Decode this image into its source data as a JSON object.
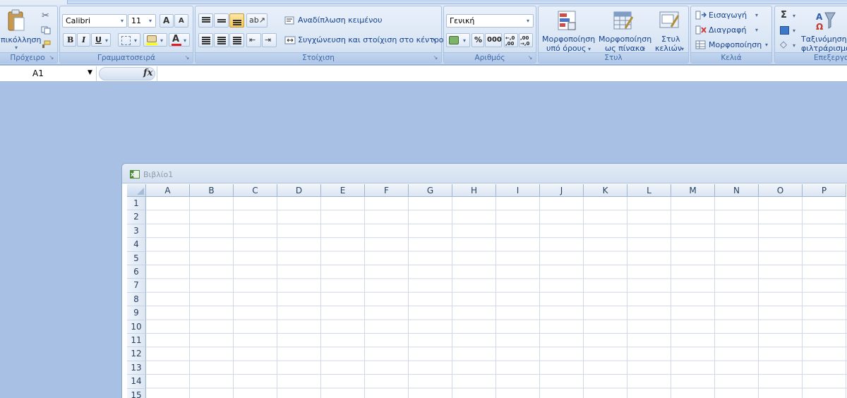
{
  "ribbon": {
    "clipboard": {
      "paste_label": "πικόλληση",
      "group_label": "Πρόχειρο"
    },
    "font": {
      "font_name": "Calibri",
      "font_size": "11",
      "grow_label": "A",
      "shrink_label": "A",
      "bold_label": "B",
      "italic_label": "I",
      "underline_label": "U",
      "color_label": "A",
      "group_label": "Γραμματοσειρά"
    },
    "alignment": {
      "wrap_label": "Αναδίπλωση κειμένου",
      "merge_label": "Συγχώνευση και στοίχιση στο κέντρο",
      "group_label": "Στοίχιση"
    },
    "number": {
      "format_value": "Γενική",
      "percent_label": "%",
      "comma_label": "000",
      "inc_decimal_label": "←,0 ,00",
      "dec_decimal_label": ",00 →,0",
      "group_label": "Αριθμός"
    },
    "styles": {
      "conditional_label_1": "Μορφοποίηση",
      "conditional_label_2": "υπό όρους",
      "table_label_1": "Μορφοποίηση",
      "table_label_2": "ως πίνακα",
      "cell_styles_label_1": "Στυλ",
      "cell_styles_label_2": "κελιών",
      "group_label": "Στυλ"
    },
    "cells": {
      "insert_label": "Εισαγωγή",
      "delete_label": "Διαγραφή",
      "format_label": "Μορφοποίηση",
      "group_label": "Κελιά"
    },
    "editing": {
      "sum_label": "Σ",
      "sort_label_1": "Ταξινόμηση &",
      "sort_label_2": "φιλτράρισμα",
      "group_label": "Επεξεργα"
    }
  },
  "formula_bar": {
    "name_box_value": "A1",
    "fx_label": "fx",
    "formula_value": ""
  },
  "workbook": {
    "title": "Βιβλίο1",
    "columns": [
      "A",
      "B",
      "C",
      "D",
      "E",
      "F",
      "G",
      "H",
      "I",
      "J",
      "K",
      "L",
      "M",
      "N",
      "O",
      "P"
    ],
    "rows": [
      "1",
      "2",
      "3",
      "4",
      "5",
      "6",
      "7",
      "8",
      "9",
      "10",
      "11",
      "12",
      "13",
      "14",
      "15"
    ]
  },
  "colors": {
    "app_background": "#a7c0e4",
    "ribbon_text": "#15428b",
    "grid_line": "#d0d7e5"
  }
}
